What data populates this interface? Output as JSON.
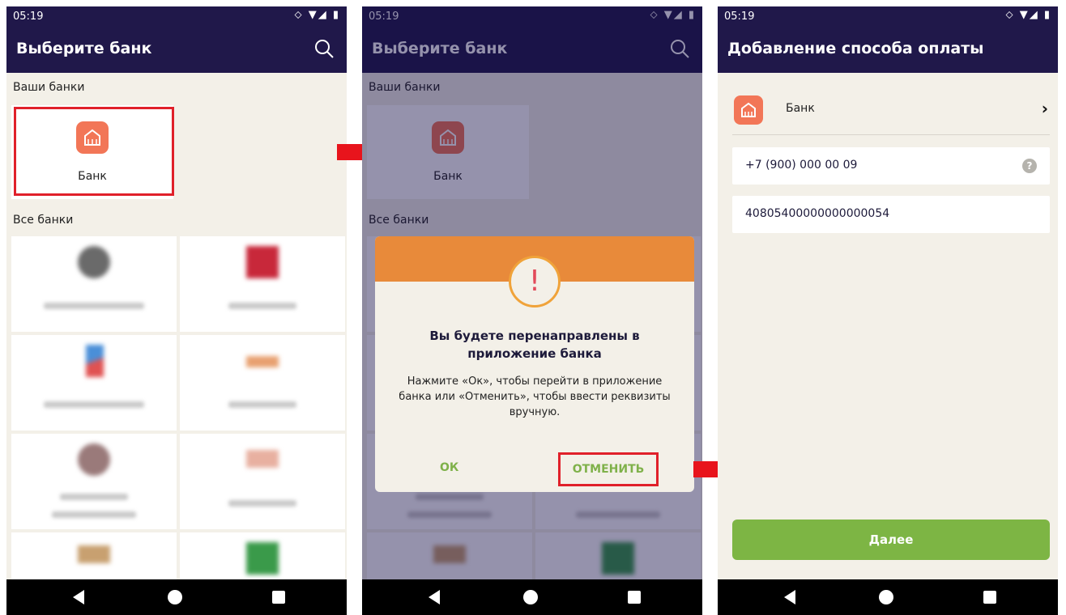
{
  "status": {
    "time": "05:19",
    "icons": "⬦ ▼◢ ▮"
  },
  "screen1": {
    "title": "Выберите банк",
    "my_banks_label": "Ваши банки",
    "my_bank_name": "Банк",
    "all_banks_label": "Все банки"
  },
  "screen2": {
    "title": "Выберите банк",
    "my_banks_label": "Ваши банки",
    "my_bank_name": "Банк",
    "all_banks_label": "Все банки",
    "dialog": {
      "icon": "!",
      "title": "Вы будете перенаправлены в приложение банка",
      "text": "Нажмите «Ок», чтобы перейти в приложение банка или «Отменить», чтобы ввести реквизиты вручную.",
      "ok_label": "ОК",
      "cancel_label": "ОТМЕНИТЬ"
    }
  },
  "screen3": {
    "title": "Добавление способа оплаты",
    "bank_name": "Банк",
    "phone_value": "+7 (900) 000 00 09",
    "help_icon": "?",
    "account_value": "40805400000000000054",
    "next_label": "Далее"
  },
  "colors": {
    "header_bg": "#20184a",
    "screen_bg": "#f3f0e8",
    "bank_icon": "#f27657",
    "dialog_header": "#e88a3a",
    "accent_green": "#7db544",
    "highlight_red": "#e0202a"
  }
}
